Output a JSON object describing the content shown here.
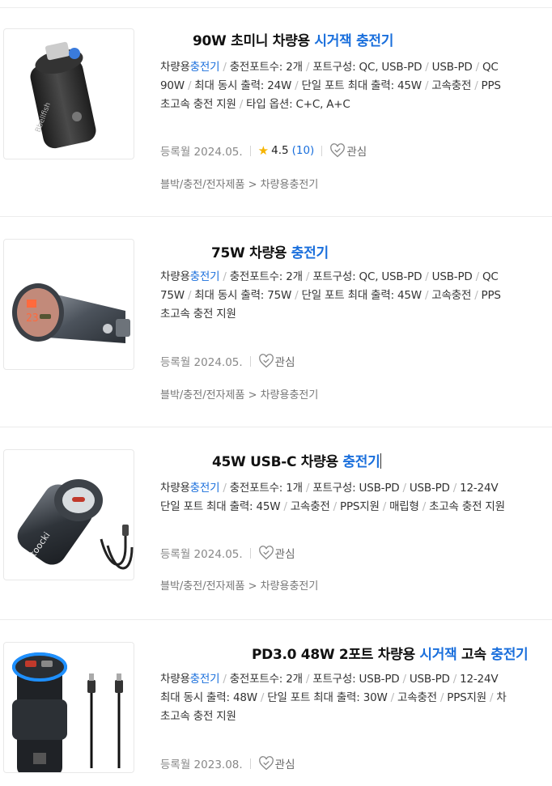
{
  "products": [
    {
      "title_parts": [
        {
          "text": "90W 초미니 차량용 ",
          "hl": false
        },
        {
          "text": "시거잭",
          "hl": true
        },
        {
          "text": " ",
          "hl": false
        },
        {
          "text": "충전기",
          "hl": true
        }
      ],
      "spec_lines": [
        [
          "차량용|충전기",
          "충전포트수: 2개",
          "포트구성: QC, USB-PD",
          "USB-PD",
          "QC"
        ],
        [
          "90W",
          "최대 동시 출력: 24W",
          "단일 포트 최대 출력: 45W",
          "고속충전",
          "PPS"
        ],
        [
          "초고속 충전 지원",
          "타입 옵션: C+C, A+C"
        ]
      ],
      "registered": "등록월 2024.05.",
      "rating": "4.5",
      "review_count": "(10)",
      "wish_label": "관심",
      "category": "블박/충전/전자제품 > 차량용충전기",
      "has_rating": true
    },
    {
      "title_parts": [
        {
          "text": "75W 차량용 ",
          "hl": false
        },
        {
          "text": "충전기",
          "hl": true
        }
      ],
      "spec_lines": [
        [
          "차량용|충전기",
          "충전포트수: 2개",
          "포트구성: QC, USB-PD",
          "USB-PD",
          "QC"
        ],
        [
          "75W",
          "최대 동시 출력: 75W",
          "단일 포트 최대 출력: 45W",
          "고속충전",
          "PPS"
        ],
        [
          "초고속 충전 지원"
        ]
      ],
      "registered": "등록월 2024.05.",
      "wish_label": "관심",
      "category": "블박/충전/전자제품 > 차량용충전기",
      "has_rating": false
    },
    {
      "title_parts": [
        {
          "text": "45W USB-C 차량용 ",
          "hl": false
        },
        {
          "text": "충전기",
          "hl": true
        }
      ],
      "spec_lines": [
        [
          "차량용|충전기",
          "충전포트수: 1개",
          "포트구성: USB-PD",
          "USB-PD",
          "12-24V"
        ],
        [
          "단일 포트 최대 출력: 45W",
          "고속충전",
          "PPS지원",
          "매립형",
          "초고속 충전 지원"
        ]
      ],
      "registered": "등록월 2024.05.",
      "wish_label": "관심",
      "category": "블박/충전/전자제품 > 차량용충전기",
      "has_rating": false
    },
    {
      "title_parts": [
        {
          "text": "PD3.0 48W 2포트 차량용 ",
          "hl": false
        },
        {
          "text": "시거잭",
          "hl": true
        },
        {
          "text": " 고속 ",
          "hl": false
        },
        {
          "text": "충전기",
          "hl": true
        }
      ],
      "spec_lines": [
        [
          "차량용|충전기",
          "충전포트수: 2개",
          "포트구성: USB-PD",
          "USB-PD",
          "12-24V"
        ],
        [
          "최대 동시 출력: 48W",
          "단일 포트 최대 출력: 30W",
          "고속충전",
          "PPS지원",
          "차"
        ],
        [
          "초고속 충전 지원"
        ]
      ],
      "registered": "등록월 2023.08.",
      "wish_label": "관심",
      "has_rating": false
    }
  ],
  "colors": {
    "highlight": "#1a6fdc",
    "star": "#f6b400",
    "meta_text": "#888888"
  },
  "icons": [
    "star-icon",
    "heart-check-icon",
    "text-cursor"
  ]
}
